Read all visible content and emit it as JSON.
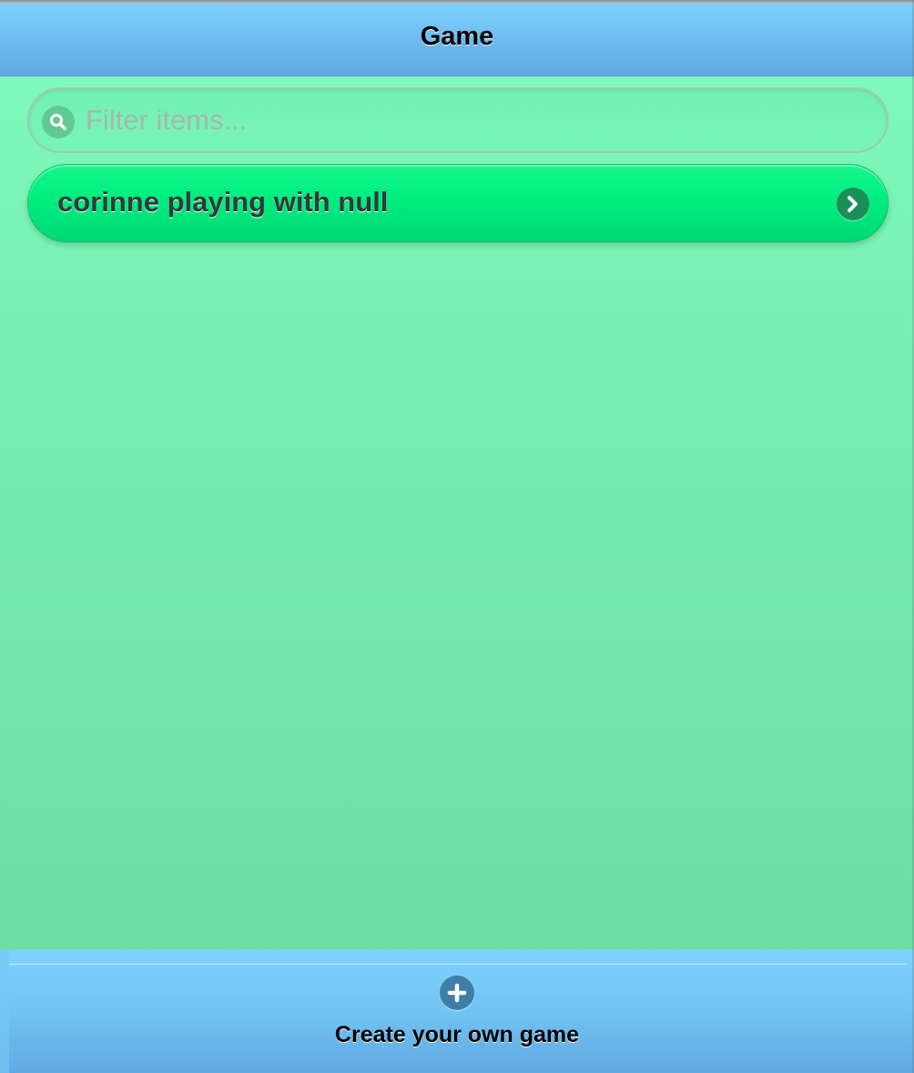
{
  "header": {
    "title": "Game"
  },
  "search": {
    "placeholder": "Filter items...",
    "value": "",
    "icon": "search-icon"
  },
  "list": {
    "items": [
      {
        "label": "corinne playing with null",
        "icon": "chevron-right-icon"
      }
    ]
  },
  "footer": {
    "create_label": "Create your own game",
    "icon": "plus-icon"
  },
  "colors": {
    "header_bar": "#72c3f3",
    "background": "#76ecb0",
    "list_item": "#00ef80"
  }
}
